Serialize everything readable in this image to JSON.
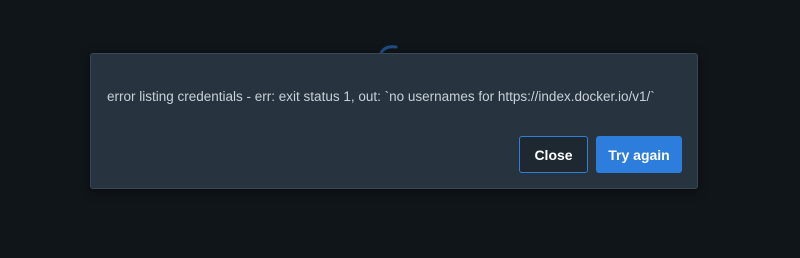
{
  "colors": {
    "background": "#10151a",
    "dialog_background": "#27333e",
    "message_text": "#c8d0d8",
    "primary_button": "#2d7ddc",
    "secondary_button_border": "#2f7fd9",
    "logo_fragment": "#1f4f86"
  },
  "background": {
    "logo_icon": "docker-logo-icon"
  },
  "dialog": {
    "message": "error listing credentials - err: exit status 1, out: `no usernames for https://index.docker.io/v1/`",
    "buttons": {
      "close_label": "Close",
      "retry_label": "Try again"
    }
  }
}
